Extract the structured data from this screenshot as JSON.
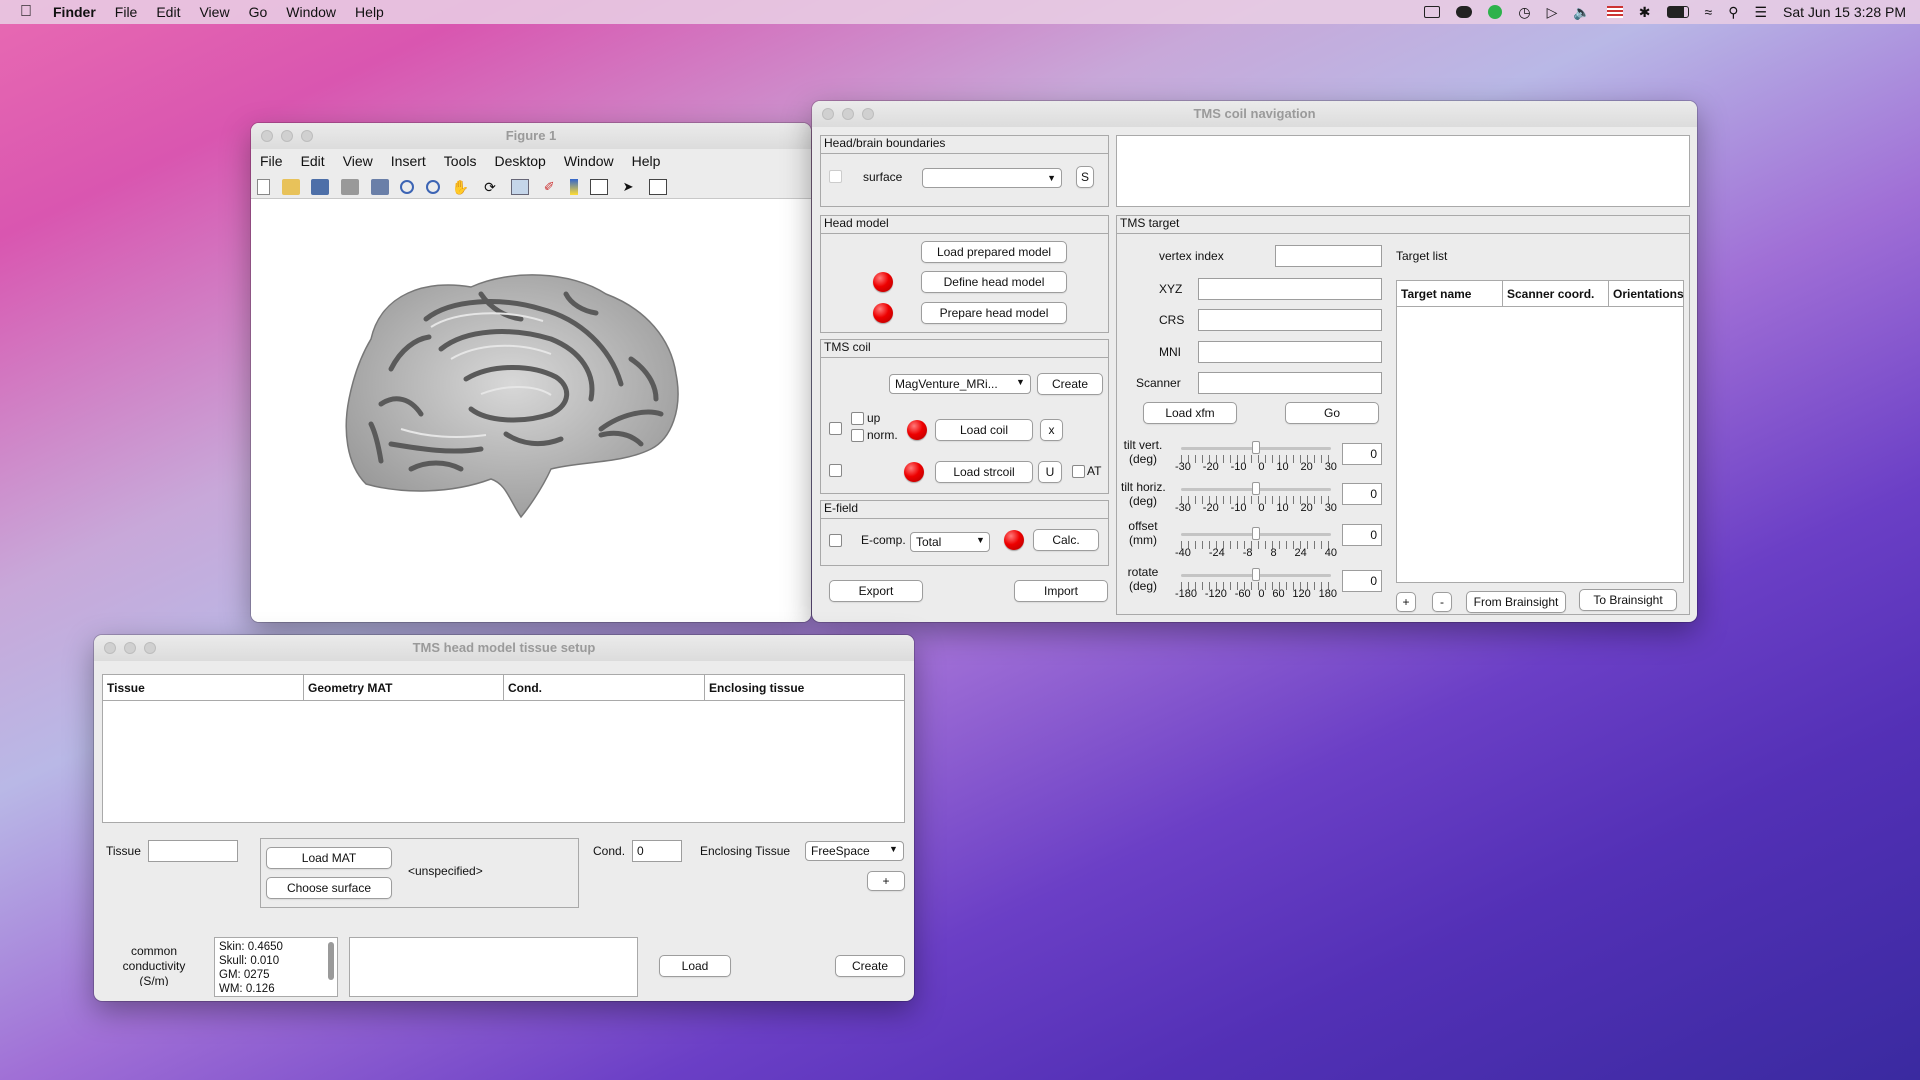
{
  "menubar": {
    "app": "Finder",
    "items": [
      "File",
      "Edit",
      "View",
      "Go",
      "Window",
      "Help"
    ],
    "clock": "Sat Jun 15  3:28 PM"
  },
  "figure": {
    "title": "Figure 1",
    "menu": [
      "File",
      "Edit",
      "View",
      "Insert",
      "Tools",
      "Desktop",
      "Window",
      "Help"
    ]
  },
  "nav": {
    "title": "TMS coil navigation",
    "boundaries": {
      "title": "Head/brain boundaries",
      "surface_label": "surface",
      "s_btn": "S"
    },
    "head_model": {
      "title": "Head model",
      "load_prepared": "Load prepared model",
      "define": "Define head model",
      "prepare": "Prepare head model"
    },
    "coil": {
      "title": "TMS coil",
      "coil_select": "MagVenture_MRi...",
      "create": "Create",
      "up": "up",
      "norm": "norm.",
      "load_coil": "Load coil",
      "x_btn": "x",
      "load_strcoil": "Load strcoil",
      "u_btn": "U",
      "at": "AT"
    },
    "efield": {
      "title": "E-field",
      "ecomp": "E-comp.",
      "ecomp_value": "Total",
      "calc": "Calc."
    },
    "export": "Export",
    "import": "Import",
    "target": {
      "title": "TMS target",
      "vertex": "vertex index",
      "xyz": "XYZ",
      "crs": "CRS",
      "mni": "MNI",
      "scanner": "Scanner",
      "load_xfm": "Load xfm",
      "go": "Go",
      "tilt_vert": "tilt vert.\n(deg)",
      "tilt_horiz": "tilt horiz.\n(deg)",
      "offset": "offset\n(mm)",
      "rotate": "rotate\n(deg)",
      "tilt_vert_value": "0",
      "tilt_horiz_value": "0",
      "offset_value": "0",
      "rotate_value": "0",
      "tilt_vert_level": 0.5,
      "tilt_horiz_level": 0.5,
      "offset_level": 0.5,
      "rotate_level": 0.5,
      "tilt_ticks": [
        "-30",
        "-20",
        "-10",
        "0",
        "10",
        "20",
        "30"
      ],
      "offset_ticks": [
        "-40",
        "-24",
        "-8",
        "8",
        "24",
        "40"
      ],
      "rotate_ticks": [
        "-180",
        "-120",
        "-60",
        "0",
        "60",
        "120",
        "180"
      ]
    },
    "target_list": {
      "title": "Target list",
      "cols": [
        "Target name",
        "Scanner coord.",
        "Orientations"
      ],
      "plus": "+",
      "minus": "-",
      "from": "From Brainsight",
      "to": "To Brainsight"
    }
  },
  "tissue": {
    "title": "TMS head model tissue setup",
    "cols": [
      "Tissue",
      "Geometry MAT",
      "Cond.",
      "Enclosing tissue"
    ],
    "tissue_label": "Tissue",
    "load_mat": "Load MAT",
    "choose_surface": "Choose surface",
    "unspecified": "<unspecified>",
    "cond_label": "Cond.",
    "cond_value": "0",
    "enclosing_label": "Enclosing Tissue",
    "enclosing_value": "FreeSpace",
    "plus": "+",
    "common_label": "common\nconductivity\n(S/m)",
    "conductivity": [
      "Skin: 0.4650",
      "Skull: 0.010",
      "GM: 0275",
      "WM: 0.126"
    ],
    "load": "Load",
    "create": "Create"
  }
}
